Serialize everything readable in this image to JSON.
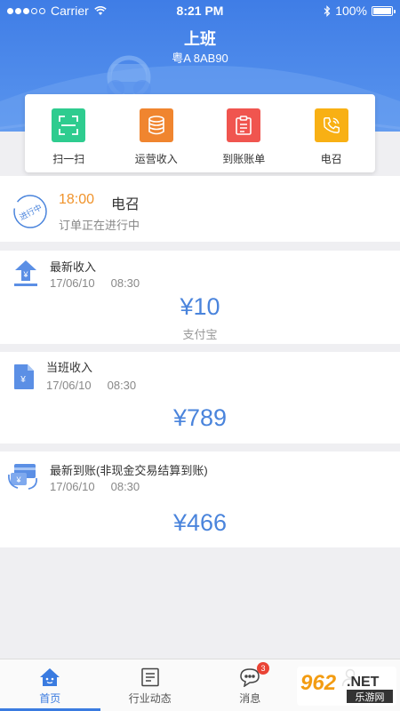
{
  "status_bar": {
    "carrier": "Carrier",
    "time": "8:21 PM",
    "battery": "100%"
  },
  "header": {
    "title": "上班",
    "plate": "粤A 8AB90"
  },
  "quick_actions": [
    {
      "label": "扫一扫",
      "icon": "scan-icon",
      "color": "#2ecc8f"
    },
    {
      "label": "运营收入",
      "icon": "coins-icon",
      "color": "#f0852f"
    },
    {
      "label": "到账账单",
      "icon": "clipboard-icon",
      "color": "#f0554f"
    },
    {
      "label": "电召",
      "icon": "phone-icon",
      "color": "#f8b014"
    }
  ],
  "order": {
    "stamp": "进行中",
    "time": "18:00",
    "type": "电召",
    "status": "订单正在进行中"
  },
  "cards": [
    {
      "title": "最新收入",
      "date": "17/06/10",
      "time": "08:30",
      "amount": "¥10",
      "method": "支付宝",
      "icon": "income-upload-icon"
    },
    {
      "title": "当班收入",
      "date": "17/06/10",
      "time": "08:30",
      "amount": "¥789",
      "icon": "document-yen-icon"
    },
    {
      "title": "最新到账(非现金交易结算到账)",
      "date": "17/06/10",
      "time": "08:30",
      "amount": "¥466",
      "icon": "card-transfer-icon"
    }
  ],
  "tabs": [
    {
      "label": "首页",
      "icon": "home-icon",
      "active": true
    },
    {
      "label": "行业动态",
      "icon": "news-icon"
    },
    {
      "label": "消息",
      "icon": "message-icon",
      "badge": "3"
    },
    {
      "label": "",
      "icon": "profile-icon"
    }
  ],
  "watermark": {
    "brand": "962",
    "suffix": ".NET",
    "subtitle": "乐游网"
  },
  "colors": {
    "primary": "#3f7de6",
    "amount": "#4a84dc",
    "highlight_time": "#f0932b"
  }
}
